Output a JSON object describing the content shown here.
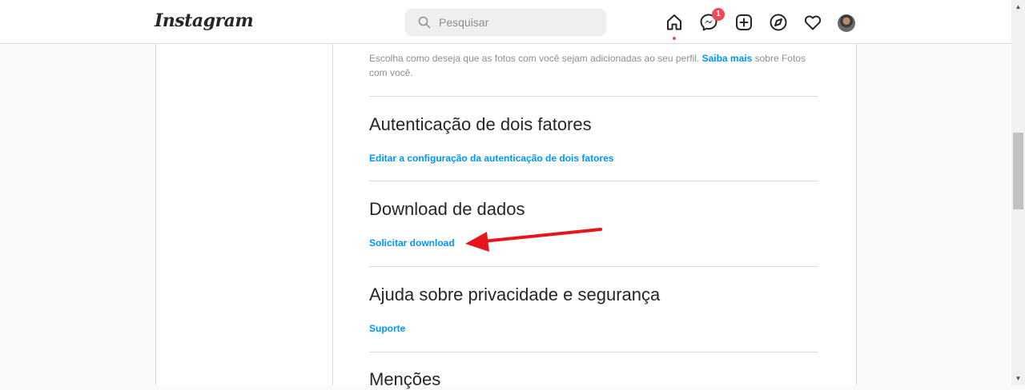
{
  "nav": {
    "logo": "Instagram",
    "search_placeholder": "Pesquisar",
    "messenger_badge": "1"
  },
  "settings": {
    "photos_desc_text": "Escolha como deseja que as fotos com você sejam adicionadas ao seu perfil. ",
    "photos_desc_link": "Saiba mais",
    "photos_desc_after": " sobre Fotos com você.",
    "sections": [
      {
        "title": "Autenticação de dois fatores",
        "link": "Editar a configuração da autenticação de dois fatores"
      },
      {
        "title": "Download de dados",
        "link": "Solicitar download"
      },
      {
        "title": "Ajuda sobre privacidade e segurança",
        "link": "Suporte"
      },
      {
        "title": "Menções"
      }
    ]
  },
  "annotation": {
    "arrow_color": "#e8141b"
  },
  "colors": {
    "link": "#0095f6",
    "badge": "#ed4956",
    "border": "#dbdbdb"
  }
}
